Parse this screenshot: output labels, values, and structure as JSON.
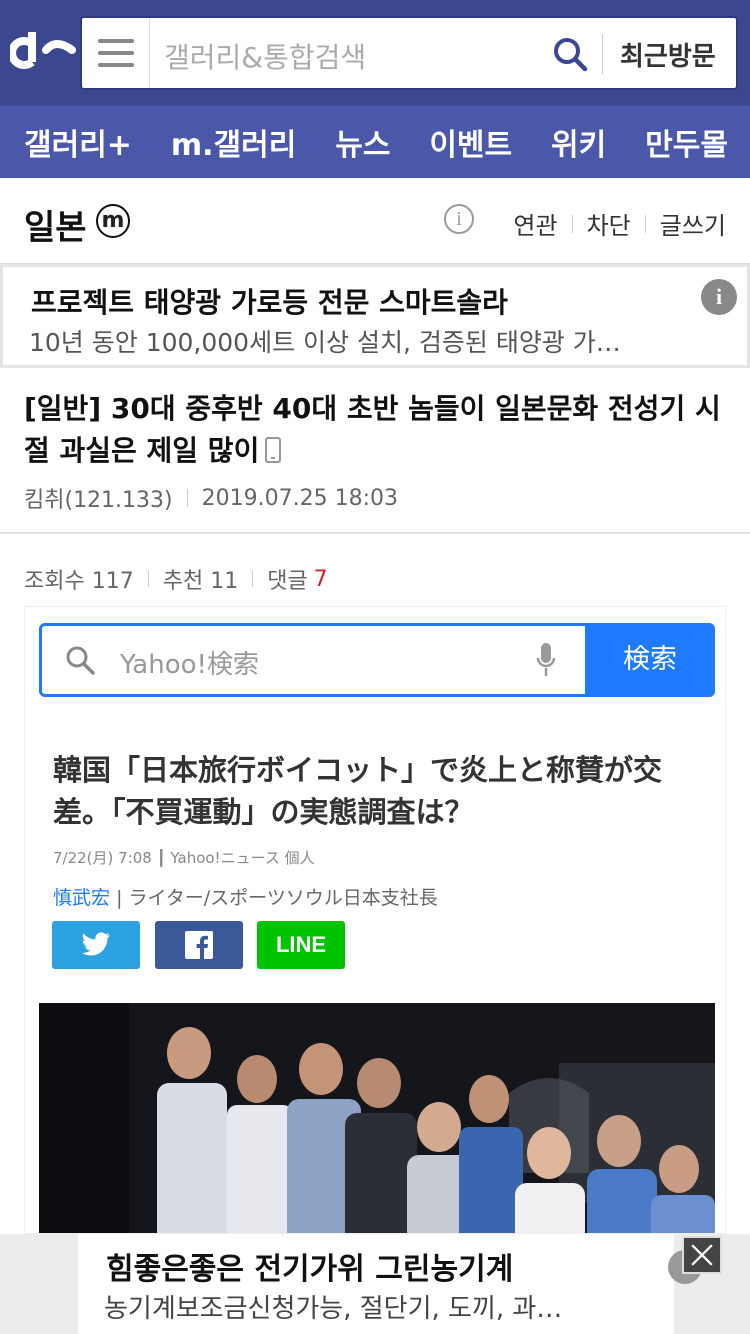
{
  "header": {
    "logo_icon": "dc-logo",
    "search_placeholder": "갤러리&통합검색",
    "recent_label": "최근방문"
  },
  "nav": [
    "갤러리+",
    "m.갤러리",
    "뉴스",
    "이벤트",
    "위키",
    "만두몰"
  ],
  "gallery": {
    "title": "일본",
    "badge": "ⓜ",
    "info_icon": "i",
    "links": [
      "연관",
      "차단",
      "글쓰기"
    ]
  },
  "ad_top": {
    "title": "프로젝트 태양광 가로등 전문 스마트솔라",
    "desc": "10년 동안 100,000세트 이상 설치, 검증된 태양광 가…",
    "info": "i"
  },
  "post": {
    "title": "[일반] 30대 중후반 40대 초반 놈들이 일본문화 전성기 시절 과실은 제일 많이",
    "author": "킴취(121.133)",
    "datetime": "2019.07.25 18:03",
    "views": "조회수 117",
    "recommend": "추천 11",
    "comments_label": "댓글",
    "comments_count": "7"
  },
  "embed": {
    "yahoo_placeholder": "Yahoo!検索",
    "yahoo_button": "検索",
    "article_title": "韓国「日本旅行ボイコット」で炎上と称賛が交差。「不買運動」の実態調査は？",
    "article_meta": "7/22(月) 7:08 ┃ Yahoo!ニュース 個人",
    "author_name": "慎武宏",
    "author_desc": "| ライター/スポーツソウル日本支社長",
    "share_line": "LINE"
  },
  "ad_bottom": {
    "title": "힘좋은좋은 전기가위 그린농기계",
    "desc": "농기계보조금신청가능, 절단기, 도끼, 과…"
  },
  "colors": {
    "header_bg": "#3b4890",
    "nav_bg": "#4b58a9",
    "yahoo_blue": "#1e7aff",
    "comment_red": "#d31f2b"
  }
}
